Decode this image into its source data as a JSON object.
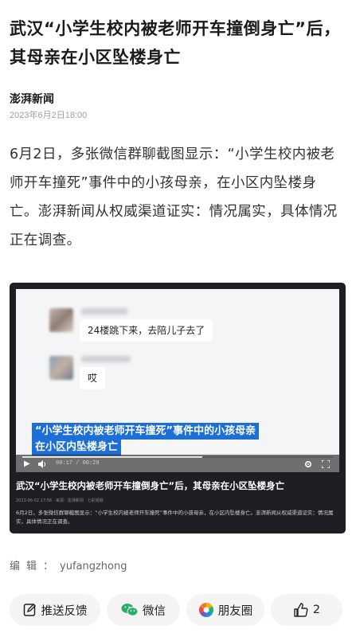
{
  "article": {
    "title": "武汉“小学生校内被老师开车撞倒身亡”后，其母亲在小区坠楼身亡",
    "source": "澎湃新闻",
    "timestamp": "2023年6月2日18:00",
    "body": "6月2日，多张微信群聊截图显示：“小学生校内被老师开车撞死”事件中的小孩母亲，在小区内坠楼身亡。澎湃新闻从权威渠道证实：情况属实，具体情况正在调查。"
  },
  "video": {
    "chat_messages": [
      {
        "text": "24楼跳下来，去陪儿子去了"
      },
      {
        "text": "哎"
      }
    ],
    "caption_line1": "“小学生校内被老师开车撞死”事件中的小孩母亲",
    "caption_line2": "在小区内坠楼身亡",
    "time": "00:17 / 00:29",
    "progress": 0.58,
    "title": "武汉“小学生校内被老师开车撞倒身亡”后，其母亲在小区坠楼身亡",
    "meta": "2023-06-02 17:56  ·  来源：澎湃新闻  ·  七彩视频",
    "description": "6月2日，多张微信群聊截图显示：“小学生校内被老师开车撞死”事件中的小孩母亲，在小区内坠楼身亡。澎湃新闻从权威渠道证实：情况属实，具体情况正在调查。"
  },
  "editor": {
    "label": "编辑：",
    "name": "yufangzhong"
  },
  "actions": {
    "share_label": "推送反馈",
    "wechat_label": "微信",
    "moments_label": "朋友圈",
    "like_count": "2"
  },
  "icons": {
    "share": "feedback-icon",
    "wechat": "wechat-icon",
    "moments": "moments-icon",
    "like": "thumbs-up-icon",
    "play": "play-icon",
    "volume": "volume-icon",
    "settings": "settings-icon",
    "fullscreen": "fullscreen-icon"
  },
  "colors": {
    "caption_bg": "#1d6fd6",
    "wechat_green": "#2aae67",
    "card_bg": "#1e1f24"
  }
}
